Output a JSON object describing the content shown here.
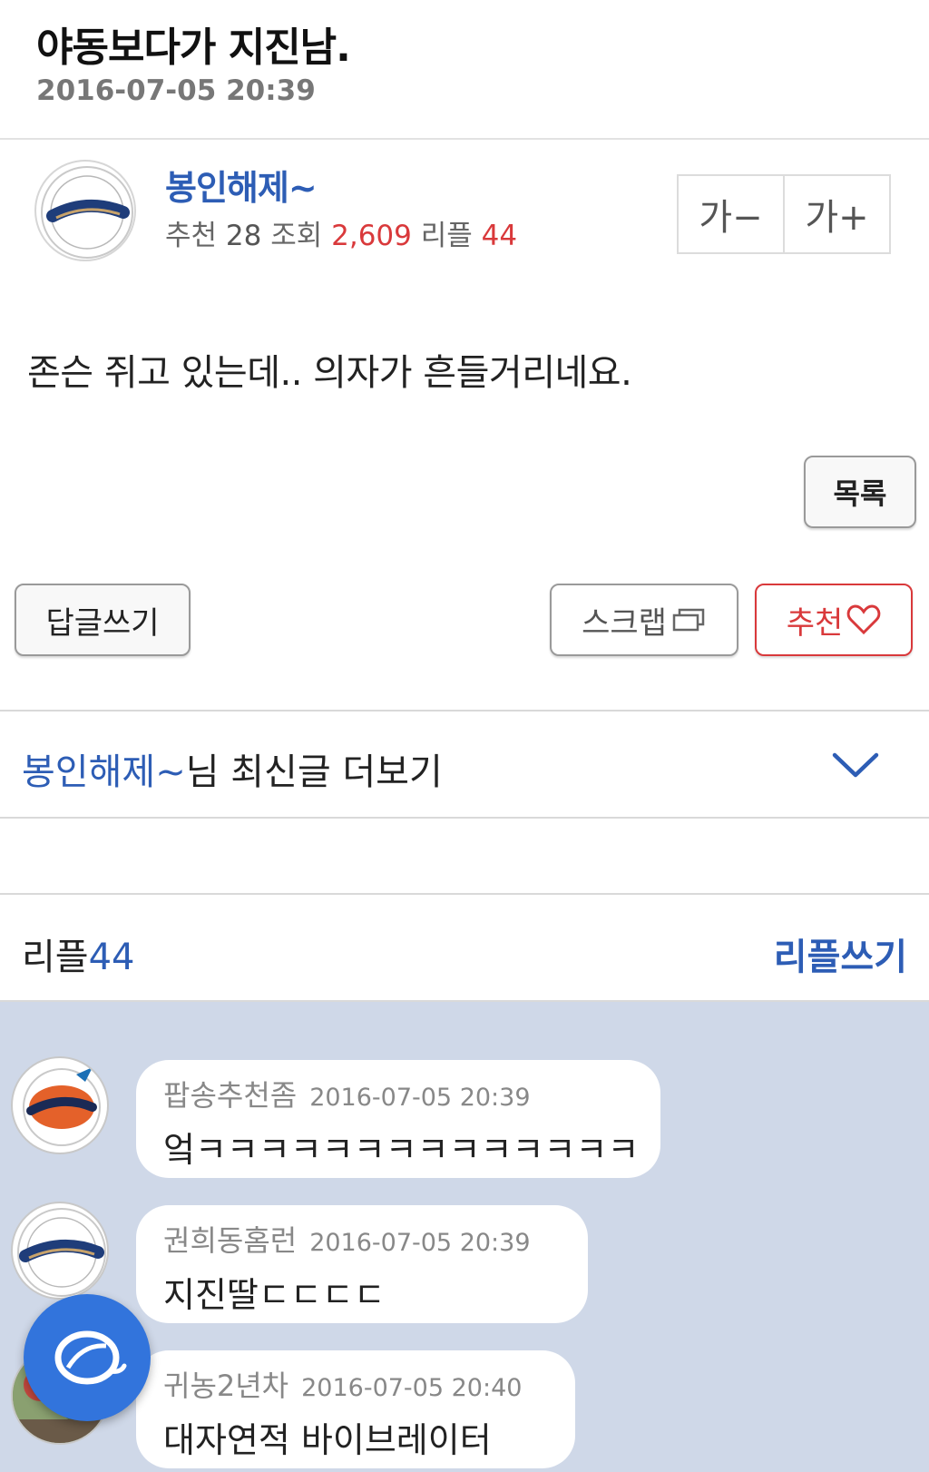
{
  "post": {
    "title": "야동보다가 지진남.",
    "date": "2016-07-05 20:39",
    "body": "존슨 쥐고 있는데.. 의자가 흔들거리네요."
  },
  "author": {
    "name": "봉인해제~",
    "avatar_icon": "nc-dinos-logo-icon",
    "recommend_label": "추천",
    "recommend_count": "28",
    "views_label": "조회",
    "views_count": "2,609",
    "replies_label": "리플",
    "replies_count": "44"
  },
  "font_controls": {
    "decrease": "가−",
    "increase": "가+"
  },
  "actions": {
    "list": "목록",
    "reply": "답글쓰기",
    "scrap": "스크랩",
    "scrap_icon": "scrap-icon",
    "recommend": "추천",
    "recommend_icon": "heart-icon"
  },
  "more_posts": {
    "nickname": "봉인해제~",
    "suffix": "님 최신글 더보기",
    "chevron_icon": "chevron-down-icon"
  },
  "reply_section": {
    "label": "리플",
    "count": "44",
    "write": "리플쓰기"
  },
  "comments": [
    {
      "author": "팝송추천좀",
      "date": "2016-07-05 20:39",
      "text": "엌ㅋㅋㅋㅋㅋㅋㅋㅋㅋㅋㅋㅋㅋㅋ",
      "avatar_icon": "giants-logo-icon"
    },
    {
      "author": "권희동홈런",
      "date": "2016-07-05 20:39",
      "text": "지진딸ㄷㄷㄷㄷ",
      "avatar_icon": "nc-dinos-logo-icon"
    },
    {
      "author": "귀농2년차",
      "date": "2016-07-05 20:40",
      "text": "대자연적 바이브레이터",
      "avatar_icon": "photo-avatar-icon"
    }
  ],
  "fab": {
    "icon": "baseball-app-icon"
  },
  "colors": {
    "accent_blue": "#2d5db5",
    "accent_red": "#d9393b",
    "comment_bg": "#cfd8e8",
    "fab_blue": "#3274dc"
  }
}
